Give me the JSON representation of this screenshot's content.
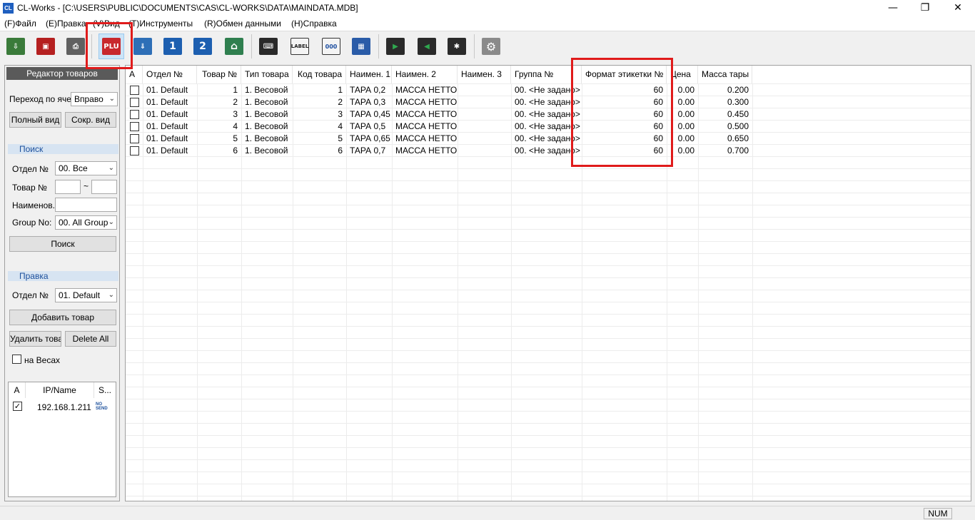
{
  "window": {
    "app_icon": "CL",
    "title": "CL-Works - [C:\\USERS\\PUBLIC\\DOCUMENTS\\CAS\\CL-WORKS\\DATA\\MAINDATA.MDB]",
    "minimize": "—",
    "maximize": "❐",
    "close": "✕"
  },
  "menu": {
    "items": [
      "(F)Файл",
      "(E)Правка",
      "(V)Вид",
      "(T)Инструменты",
      "(R)Обмен данными",
      "(H)Справка"
    ]
  },
  "toolbar": {
    "buttons": [
      {
        "icon": "import-icon"
      },
      {
        "icon": "save-icon"
      },
      {
        "icon": "print-icon"
      },
      {
        "icon": "plu-icon",
        "label": "PLU",
        "active": true
      },
      {
        "icon": "download-icon"
      },
      {
        "icon": "one-icon",
        "label": "1"
      },
      {
        "icon": "two-icon",
        "label": "2"
      },
      {
        "icon": "house-icon"
      },
      {
        "icon": "keyboard-icon"
      },
      {
        "icon": "label-icon",
        "label": "LABEL"
      },
      {
        "icon": "barcode-icon",
        "label": "000"
      },
      {
        "icon": "grid-icon"
      },
      {
        "icon": "monitor-send-icon"
      },
      {
        "icon": "monitor-receive-icon"
      },
      {
        "icon": "monitor-settings-icon"
      },
      {
        "icon": "gear-icon"
      }
    ]
  },
  "left_panel": {
    "title": "Редактор товаров",
    "goto_label": "Переход по ячей",
    "goto_value": "Вправо",
    "full_view": "Полный вид",
    "short_view": "Сокр. вид",
    "search": {
      "header": "Поиск",
      "dept_label": "Отдел №",
      "dept_value": "00. Все",
      "item_label": "Товар №",
      "range_sep": "~",
      "name_label": "Наименов.",
      "group_label": "Group No:",
      "group_value": "00. All Group",
      "search_button": "Поиск"
    },
    "edit": {
      "header": "Правка",
      "dept_label": "Отдел №",
      "dept_value": "01. Default",
      "add_button": "Добавить товар",
      "delete_button": "Удалить товар",
      "delete_all_button": "Delete All",
      "on_scales_label": "на Весах"
    },
    "devices": {
      "columns": [
        "A",
        "IP/Name",
        "S..."
      ],
      "rows": [
        {
          "checked": true,
          "ip": "192.168.1.211",
          "status": "NO SEND"
        }
      ]
    }
  },
  "grid": {
    "columns": [
      "A",
      "Отдел №",
      "Товар №",
      "Тип товара",
      "Код товара",
      "Наимен. 1",
      "Наимен. 2",
      "Наимен. 3",
      "Группа №",
      "Формат этикетки №",
      "Цена",
      "Масса тары"
    ],
    "rows": [
      [
        "01. Default",
        "1",
        "1. Весовой",
        "1",
        "ТАРА 0,2",
        "МАССА НЕТТО:",
        "",
        "00. <Не задано>",
        "60",
        "0.00",
        "0.200"
      ],
      [
        "01. Default",
        "2",
        "1. Весовой",
        "2",
        "ТАРА 0,3",
        "МАССА НЕТТО:",
        "",
        "00. <Не задано>",
        "60",
        "0.00",
        "0.300"
      ],
      [
        "01. Default",
        "3",
        "1. Весовой",
        "3",
        "ТАРА 0,45",
        "МАССА НЕТТО:",
        "",
        "00. <Не задано>",
        "60",
        "0.00",
        "0.450"
      ],
      [
        "01. Default",
        "4",
        "1. Весовой",
        "4",
        "ТАРА 0,5",
        "МАССА НЕТТО:",
        "",
        "00. <Не задано>",
        "60",
        "0.00",
        "0.500"
      ],
      [
        "01. Default",
        "5",
        "1. Весовой",
        "5",
        "ТАРА 0,65",
        "МАССА НЕТТО:",
        "",
        "00. <Не задано>",
        "60",
        "0.00",
        "0.650"
      ],
      [
        "01. Default",
        "6",
        "1. Весовой",
        "6",
        "ТАРА 0,7",
        "МАССА НЕТТО:",
        "",
        "00. <Не задано>",
        "60",
        "0.00",
        "0.700"
      ]
    ]
  },
  "status": {
    "num": "NUM"
  }
}
